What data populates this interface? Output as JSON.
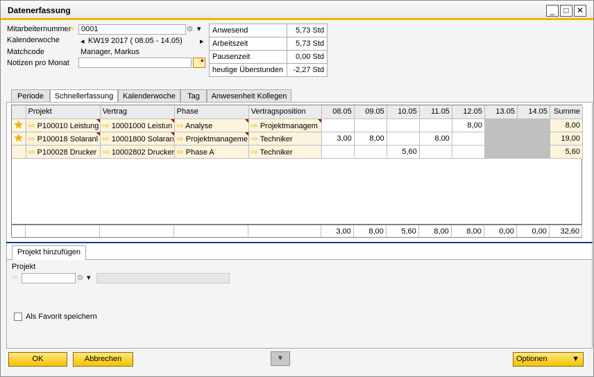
{
  "window": {
    "title": "Datenerfassung",
    "min": "_",
    "max": "□",
    "close": "✕"
  },
  "header": {
    "employee_label": "Mitarbeiternummer",
    "employee_value": "0001",
    "week_label": "Kalenderwoche",
    "week_value": "KW19  2017 ( 08.05 - 14.05)",
    "matchcode_label": "Matchcode",
    "matchcode_value": "Manager, Markus",
    "notes_label": "Notizen pro Monat",
    "notes_value": ""
  },
  "summary": {
    "rows": [
      {
        "label": "Anwesend",
        "value": "5,73 Std"
      },
      {
        "label": "Arbeitszeit",
        "value": "5,73 Std"
      },
      {
        "label": "Pausenzeit",
        "value": "0,00 Std"
      },
      {
        "label": "heutige Überstunden",
        "value": "-2,27 Std"
      }
    ]
  },
  "tabs": [
    "Periode",
    "Schnellerfassung",
    "Kalenderwoche",
    "Tag",
    "Anwesenheit Kollegen"
  ],
  "grid": {
    "columns": [
      "Projekt",
      "Vertrag",
      "Phase",
      "Vertragsposition",
      "08.05",
      "09.05",
      "10.05",
      "11.05",
      "12.05",
      "13.05",
      "14.05",
      "Summe"
    ],
    "rows": [
      {
        "fav": true,
        "projekt": "P100010 Leistung",
        "vertrag": "10001000 Leistun",
        "phase": "Analyse",
        "position": "Projektmanagem",
        "d": [
          "",
          "",
          "",
          "",
          "8,00",
          "",
          ""
        ],
        "summe": "8,00"
      },
      {
        "fav": true,
        "projekt": "P100018 Solaranl",
        "vertrag": "10001800 Solaran",
        "phase": "Projektmanageme",
        "position": "Techniker",
        "d": [
          "3,00",
          "8,00",
          "",
          "8,00",
          "",
          "",
          ""
        ],
        "summe": "19,00"
      },
      {
        "fav": false,
        "projekt": "P100028 Drucker",
        "vertrag": "10002802 Drucker",
        "phase": "Phase A",
        "position": "Techniker",
        "d": [
          "",
          "",
          "5,60",
          "",
          "",
          "",
          ""
        ],
        "summe": "5,60"
      }
    ],
    "totals": [
      "3,00",
      "8,00",
      "5,60",
      "8,00",
      "8,00",
      "0,00",
      "0,00",
      "32,60"
    ]
  },
  "add_project": {
    "tab_label": "Projekt hinzufügen",
    "field_label": "Projekt",
    "favorite_label": "Als Favorit speichern"
  },
  "footer": {
    "ok": "OK",
    "cancel": "Abbrechen",
    "options": "Optionen"
  }
}
